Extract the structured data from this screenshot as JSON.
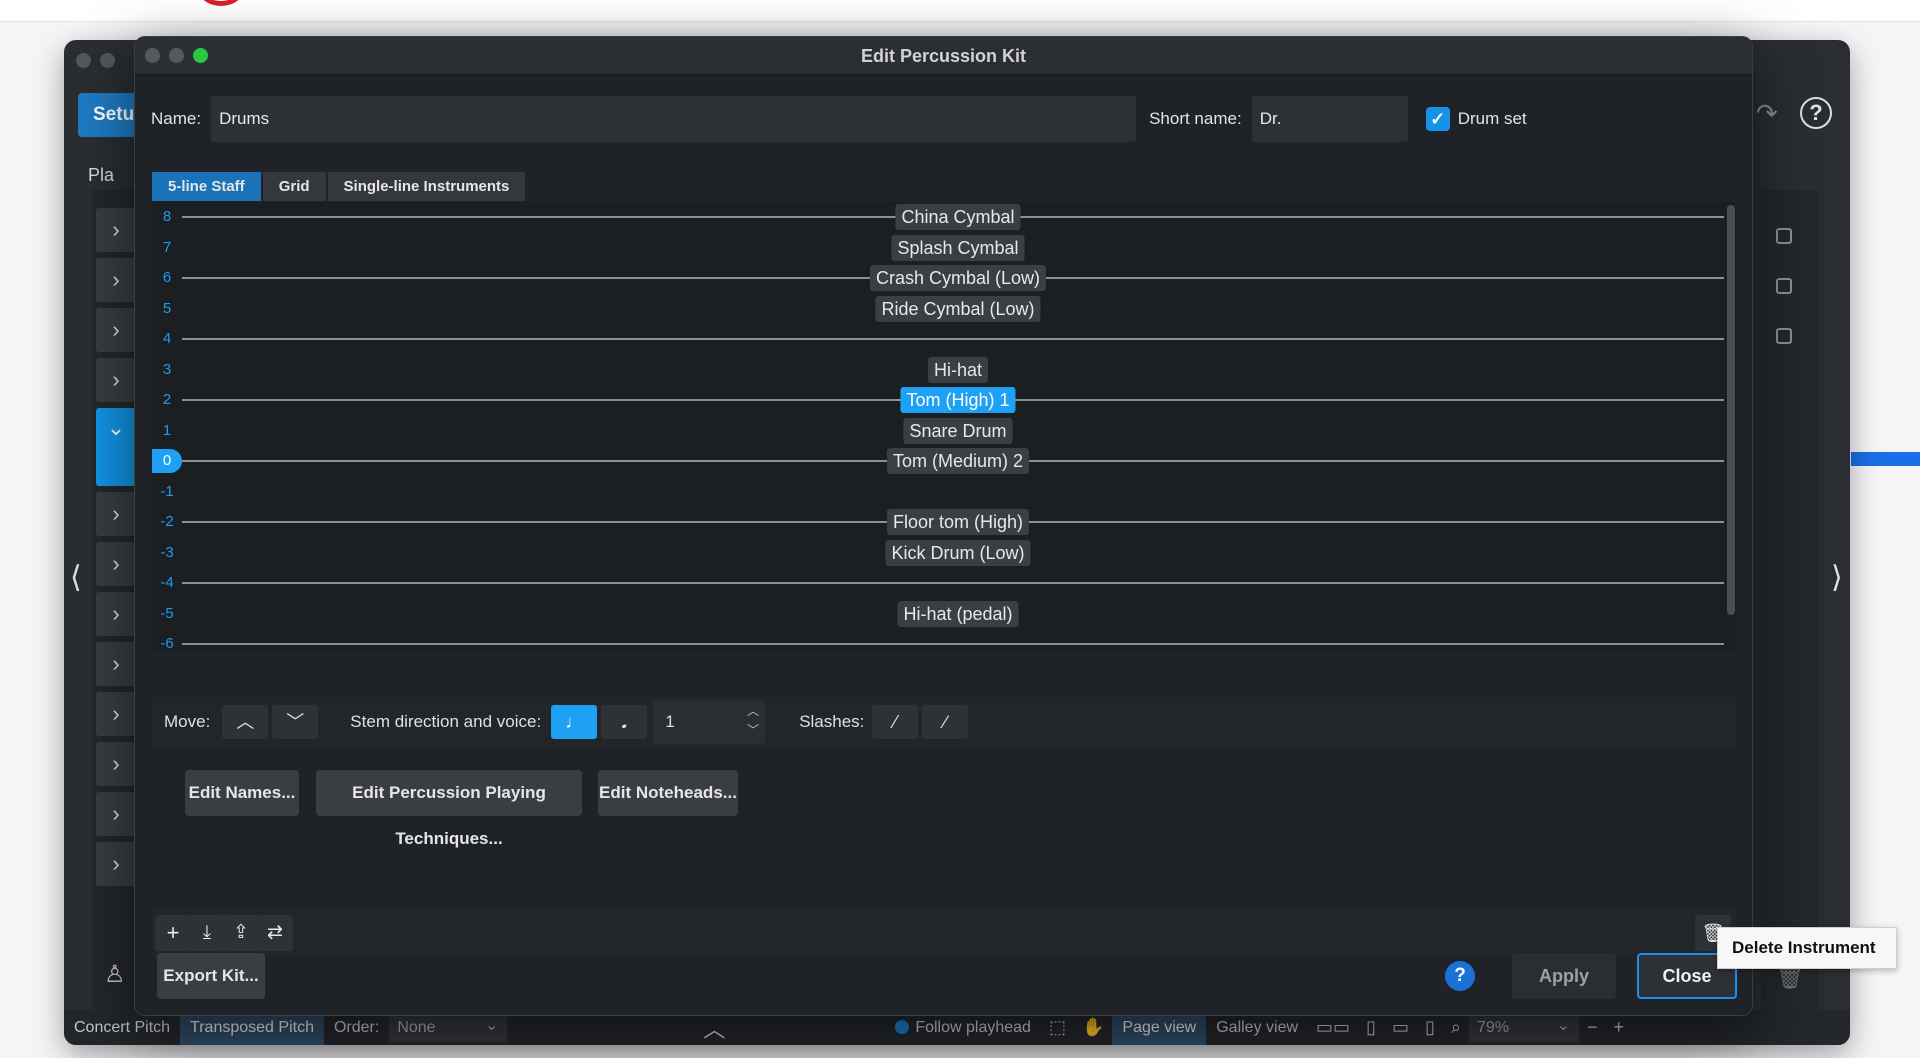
{
  "background_app": {
    "setup_tab": "Setu",
    "players_label": "Pla",
    "status": {
      "concert_pitch": "Concert Pitch",
      "transposed_pitch": "Transposed Pitch",
      "order_label": "Order:",
      "order_value": "None",
      "follow_playhead": "Follow playhead",
      "page_view": "Page view",
      "galley_view": "Galley view",
      "zoom": "79%"
    }
  },
  "dialog": {
    "title": "Edit Percussion Kit",
    "name_label": "Name:",
    "name_value": "Drums",
    "short_name_label": "Short name:",
    "short_name_value": "Dr.",
    "drum_set_label": "Drum set",
    "drum_set_checked": true,
    "tabs": [
      {
        "label": "5-line Staff",
        "active": true
      },
      {
        "label": "Grid",
        "active": false
      },
      {
        "label": "Single-line Instruments",
        "active": false
      }
    ],
    "staff_positions": [
      "8",
      "7",
      "6",
      "5",
      "4",
      "3",
      "2",
      "1",
      "0",
      "-1",
      "-2",
      "-3",
      "-4",
      "-5",
      "-6"
    ],
    "selected_position": "0",
    "instruments": [
      {
        "name": "China Cymbal",
        "position": "8",
        "selected": false
      },
      {
        "name": "Splash Cymbal",
        "position": "7",
        "selected": false
      },
      {
        "name": "Crash Cymbal (Low)",
        "position": "6",
        "selected": false
      },
      {
        "name": "Ride Cymbal (Low)",
        "position": "5",
        "selected": false
      },
      {
        "name": "Hi-hat",
        "position": "3",
        "selected": false
      },
      {
        "name": "Tom (High) 1",
        "position": "2",
        "selected": true
      },
      {
        "name": "Snare Drum",
        "position": "1",
        "selected": false
      },
      {
        "name": "Tom (Medium) 2",
        "position": "0",
        "selected": false
      },
      {
        "name": "Floor tom (High)",
        "position": "-2",
        "selected": false
      },
      {
        "name": "Kick Drum (Low)",
        "position": "-3",
        "selected": false
      },
      {
        "name": "Hi-hat (pedal)",
        "position": "-5",
        "selected": false
      }
    ],
    "controls": {
      "move_label": "Move:",
      "stem_label": "Stem direction and voice:",
      "voice_value": "1",
      "slashes_label": "Slashes:"
    },
    "buttons": {
      "edit_names": "Edit Names...",
      "edit_techniques": "Edit Percussion Playing Techniques...",
      "edit_noteheads": "Edit Noteheads...",
      "export_kit": "Export Kit...",
      "help": "?",
      "apply": "Apply",
      "close": "Close"
    },
    "tooltip": "Delete Instrument"
  },
  "colors": {
    "accent": "#1ea0f5",
    "dialog_bg": "#1f2226",
    "staff_bg": "#1c1f22"
  }
}
